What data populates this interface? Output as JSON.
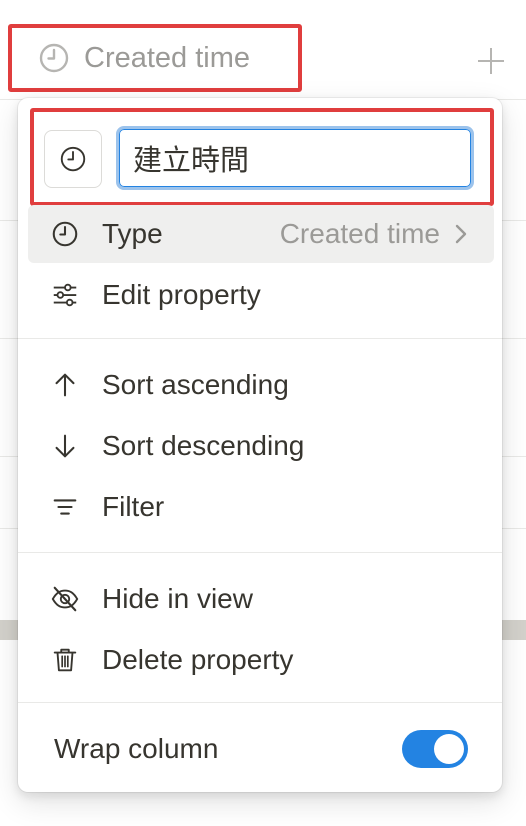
{
  "table": {
    "column_header": "Created time",
    "add_column_icon": "plus-icon"
  },
  "menu": {
    "name_input": {
      "value": "建立時間",
      "icon": "clock-icon"
    },
    "type_item": {
      "label": "Type",
      "value": "Created time",
      "icon": "clock-icon"
    },
    "edit_property": {
      "label": "Edit property",
      "icon": "sliders-icon"
    },
    "sort_ascending": {
      "label": "Sort ascending",
      "icon": "arrow-up-icon"
    },
    "sort_descending": {
      "label": "Sort descending",
      "icon": "arrow-down-icon"
    },
    "filter": {
      "label": "Filter",
      "icon": "filter-icon"
    },
    "hide_in_view": {
      "label": "Hide in view",
      "icon": "eye-slash-icon"
    },
    "delete_property": {
      "label": "Delete property",
      "icon": "trash-icon"
    },
    "wrap_column": {
      "label": "Wrap column",
      "enabled": true
    }
  },
  "colors": {
    "highlight_border": "#e03e3e",
    "accent": "#2383e2",
    "muted_text": "#9b9a97",
    "text": "#37352f"
  }
}
